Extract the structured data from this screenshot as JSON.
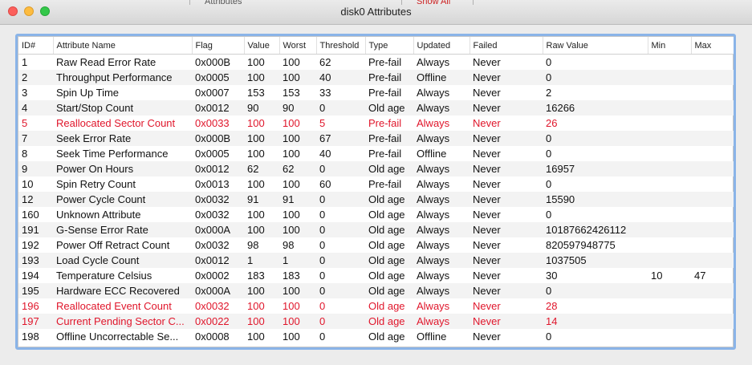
{
  "window": {
    "title": "disk0 Attributes",
    "behind_left": "Attributes",
    "behind_right": "Show All"
  },
  "columns": [
    "ID#",
    "Attribute Name",
    "Flag",
    "Value",
    "Worst",
    "Threshold",
    "Type",
    "Updated",
    "Failed",
    "Raw Value",
    "Min",
    "Max"
  ],
  "alert_color": "#e0162b",
  "rows": [
    [
      "1",
      "Raw Read Error Rate",
      "0x000B",
      "100",
      "100",
      "62",
      "Pre-fail",
      "Always",
      "Never",
      "0",
      "",
      ""
    ],
    [
      "2",
      "Throughput Performance",
      "0x0005",
      "100",
      "100",
      "40",
      "Pre-fail",
      "Offline",
      "Never",
      "0",
      "",
      ""
    ],
    [
      "3",
      "Spin Up Time",
      "0x0007",
      "153",
      "153",
      "33",
      "Pre-fail",
      "Always",
      "Never",
      "2",
      "",
      ""
    ],
    [
      "4",
      "Start/Stop Count",
      "0x0012",
      "90",
      "90",
      "0",
      "Old age",
      "Always",
      "Never",
      "16266",
      "",
      ""
    ],
    [
      "5",
      "Reallocated Sector Count",
      "0x0033",
      "100",
      "100",
      "5",
      "Pre-fail",
      "Always",
      "Never",
      "26",
      "",
      ""
    ],
    [
      "7",
      "Seek Error Rate",
      "0x000B",
      "100",
      "100",
      "67",
      "Pre-fail",
      "Always",
      "Never",
      "0",
      "",
      ""
    ],
    [
      "8",
      "Seek Time Performance",
      "0x0005",
      "100",
      "100",
      "40",
      "Pre-fail",
      "Offline",
      "Never",
      "0",
      "",
      ""
    ],
    [
      "9",
      "Power On Hours",
      "0x0012",
      "62",
      "62",
      "0",
      "Old age",
      "Always",
      "Never",
      "16957",
      "",
      ""
    ],
    [
      "10",
      "Spin Retry Count",
      "0x0013",
      "100",
      "100",
      "60",
      "Pre-fail",
      "Always",
      "Never",
      "0",
      "",
      ""
    ],
    [
      "12",
      "Power Cycle Count",
      "0x0032",
      "91",
      "91",
      "0",
      "Old age",
      "Always",
      "Never",
      "15590",
      "",
      ""
    ],
    [
      "160",
      "Unknown Attribute",
      "0x0032",
      "100",
      "100",
      "0",
      "Old age",
      "Always",
      "Never",
      "0",
      "",
      ""
    ],
    [
      "191",
      "G-Sense Error Rate",
      "0x000A",
      "100",
      "100",
      "0",
      "Old age",
      "Always",
      "Never",
      "10187662426112",
      "",
      ""
    ],
    [
      "192",
      "Power Off Retract Count",
      "0x0032",
      "98",
      "98",
      "0",
      "Old age",
      "Always",
      "Never",
      "820597948775",
      "",
      ""
    ],
    [
      "193",
      "Load Cycle Count",
      "0x0012",
      "1",
      "1",
      "0",
      "Old age",
      "Always",
      "Never",
      "1037505",
      "",
      ""
    ],
    [
      "194",
      "Temperature Celsius",
      "0x0002",
      "183",
      "183",
      "0",
      "Old age",
      "Always",
      "Never",
      "30",
      "10",
      "47"
    ],
    [
      "195",
      "Hardware ECC Recovered",
      "0x000A",
      "100",
      "100",
      "0",
      "Old age",
      "Always",
      "Never",
      "0",
      "",
      ""
    ],
    [
      "196",
      "Reallocated Event Count",
      "0x0032",
      "100",
      "100",
      "0",
      "Old age",
      "Always",
      "Never",
      "28",
      "",
      ""
    ],
    [
      "197",
      "Current Pending Sector C...",
      "0x0022",
      "100",
      "100",
      "0",
      "Old age",
      "Always",
      "Never",
      "14",
      "",
      ""
    ],
    [
      "198",
      "Offline Uncorrectable Se...",
      "0x0008",
      "100",
      "100",
      "0",
      "Old age",
      "Offline",
      "Never",
      "0",
      "",
      ""
    ]
  ],
  "alert_rows": [
    4,
    16,
    17
  ]
}
